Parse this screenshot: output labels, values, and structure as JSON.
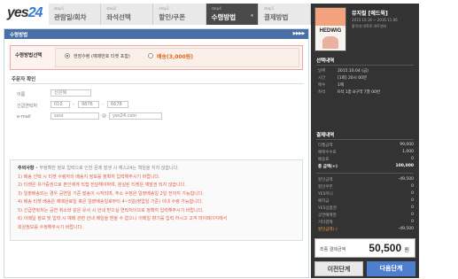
{
  "header": {
    "logo_text": "yes",
    "logo_num": "24",
    "steps": [
      {
        "num": "step1",
        "label": "관람일/회차",
        "active": false
      },
      {
        "num": "step2",
        "label": "좌석선택",
        "active": false
      },
      {
        "num": "step3",
        "label": "할인/쿠폰",
        "active": false
      },
      {
        "num": "step4",
        "label": "수령방법",
        "active": true
      },
      {
        "num": "step5",
        "label": "결제방법",
        "active": false
      }
    ]
  },
  "section": {
    "title": "수령방법",
    "arrows": "▶▶▶▶"
  },
  "method": {
    "label": "수령방법선택",
    "option1": "현장수령 (예매번호 티켓 포함)",
    "option2": "배송(3,000원)",
    "selected": "option1"
  },
  "orderer": {
    "heading": "주문자 확인",
    "name_label": "이름",
    "name_value": "신은혜",
    "phone_label": "긴급연락처",
    "phone_1": "010",
    "phone_2": "9876",
    "phone_3": "6678",
    "email_label": "e-mail",
    "email_id": "ssss",
    "email_at": "@",
    "email_domain": "yes24.com"
  },
  "notice": {
    "title": "주의사항",
    "title_rest": " • 부정확한 정보 입력으로 인한 문제 발생 시 예스24는 책임을 지지 않습니다.",
    "lines": [
      "1) 배송 선택 시 티켓 수령자의 배송지 정보를 정확히 입력해주시기 바랍니다.",
      "2) 티켓은 유가증권으로 본인에게 직접 전달해야하며, 분실된 티켓은 재발권 되지 않습니다.",
      "3) 일괄배송되는 경우 공연일 기준 발송이 시작되며, 주소 수정은 일괄배송일 2일 전까지 가능합니다.",
      "4) 배송 티켓 배송은 예매완료일 혹은 일괄배송일로부터 4~5일(영업일 기준) 이내 수령 가능합니다.",
      "5) 긴급연락처는 공연 취소와 같은 유사 시 안내 받으실 연락처이므로 정확히 입력해주시기 바랍니다.",
      "6) 이메일 정보 및 입력 시 예매 관련 안내 메일을 받을 수 없으니 이메일 향기를 입력 하시고 고객 마이페이지에서",
      "    회원정보를 수정해주시기 바랍니다."
    ]
  },
  "side": {
    "title": "뮤지컬 [헤드윅]",
    "dates": "2015.10.16 ~ 2016.11.06",
    "venue": "홍익대 대학로 아트센터",
    "poster_text": "HEDWIG",
    "selection_heading": "선택내역",
    "selection": [
      {
        "k": "날짜",
        "v": "2015.10.04 (금)"
      },
      {
        "k": "시간",
        "v": "[1회] 20시 00분"
      },
      {
        "k": "매수",
        "v": "1매"
      },
      {
        "k": "좌석",
        "v": "R석 1층 8구역 7열 00번"
      }
    ],
    "payment_heading": "결제내역",
    "prices": [
      {
        "k": "티켓금액",
        "v": "99,000"
      },
      {
        "k": "예매수수료",
        "v": "1,000"
      },
      {
        "k": "배송료",
        "v": "0"
      },
      {
        "k": "총 금액(+)",
        "v": "100,000",
        "style": "bold"
      },
      {
        "k": "",
        "v": ""
      },
      {
        "k": "할인금액",
        "v": "-49,500"
      },
      {
        "k": "할인쿠폰",
        "v": "0"
      },
      {
        "k": "YES머니",
        "v": "0"
      },
      {
        "k": "예치금",
        "v": "0"
      },
      {
        "k": "YES상품권",
        "v": "0"
      },
      {
        "k": "공연예매권",
        "v": "0"
      },
      {
        "k": "기타결제",
        "v": "0"
      },
      {
        "k": "할인금액(-)",
        "v": "-49,500",
        "style": "orange"
      }
    ],
    "total_label": "최종 결제금액",
    "total_value": "50,500",
    "total_unit": "원",
    "prev_button": "이전단계",
    "next_button": "다음단계"
  }
}
